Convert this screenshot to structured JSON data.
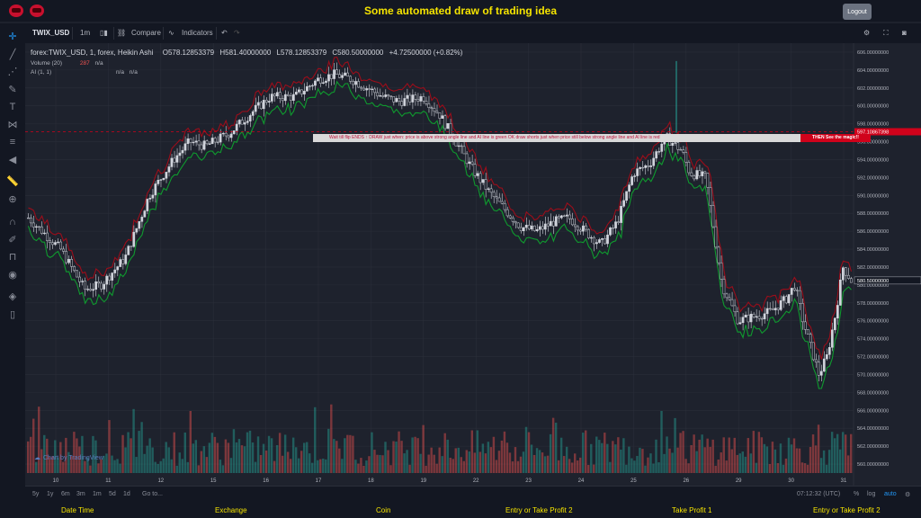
{
  "page": {
    "title": "Some automated draw of trading idea",
    "logout_label": "Logout"
  },
  "toolbar": {
    "symbol": "TWIX_USD",
    "interval": "1m",
    "compare_label": "Compare",
    "indicators_label": "Indicators"
  },
  "legend": {
    "main": "forex:TWIX_USD, 1, forex, Heikin Ashi",
    "o": "O578.12853379",
    "h": "H581.40000000",
    "l": "L578.12853379",
    "c": "C580.50000000",
    "chg": "+4.72500000 (+0.82%)",
    "volume_label": "Volume (20)",
    "volume_val": "287",
    "volume_na": "n/a",
    "ai_label": "AI (1, 1)",
    "ai_na1": "n/a",
    "ai_na2": "n/a"
  },
  "signal": {
    "text": "Wait till flip ENDS  ↑  DRAW just when:  price is above strong angle line and AI line is green        OK         draw shorts just when price still below strong angle line and AI line is red",
    "magic": "THEN See the magic!!",
    "level_label": "597.10867398"
  },
  "watermark": "Chart by TradingView",
  "footer": {
    "ranges": [
      "5y",
      "1y",
      "6m",
      "3m",
      "1m",
      "5d",
      "1d"
    ],
    "goto": "Go to...",
    "time": "07:12:32 (UTC)",
    "pct": "%",
    "log": "log",
    "auto": "auto"
  },
  "bottom_links": [
    "Date Time",
    "Exchange",
    "Coin",
    "Entry or Take Profit 2",
    "Take Profit 1",
    "Entry or Take Profit 2"
  ],
  "colors": {
    "up": "#d1d4dc",
    "down": "#131722",
    "vol_up": "#26a69a",
    "vol_down": "#ef5350",
    "angle_line": "#9b0d1a",
    "ai_line": "#0f9a2e",
    "accent": "#f5e400"
  },
  "chart_data": {
    "type": "candlestick",
    "x_ticks": [
      "10",
      "11",
      "12",
      "15",
      "16",
      "17",
      "18",
      "19",
      "22",
      "23",
      "24",
      "25",
      "26",
      "29",
      "30",
      "31"
    ],
    "y_ticks": [
      "560.00000000",
      "562.00000000",
      "564.00000000",
      "566.00000000",
      "568.00000000",
      "570.00000000",
      "572.00000000",
      "574.00000000",
      "576.00000000",
      "578.00000000",
      "580.00000000",
      "582.00000000",
      "584.00000000",
      "586.00000000",
      "588.00000000",
      "590.00000000",
      "592.00000000",
      "594.00000000",
      "596.00000000",
      "598.00000000",
      "600.00000000",
      "602.00000000",
      "604.00000000",
      "606.00000000"
    ],
    "ylim": [
      559,
      607
    ],
    "last_price": "580.50000000",
    "signal_level": 597.11,
    "close_path": [
      [
        0,
        587.5
      ],
      [
        4,
        584
      ],
      [
        7,
        579.5
      ],
      [
        9,
        580
      ],
      [
        12,
        583
      ],
      [
        15,
        590
      ],
      [
        18,
        594
      ],
      [
        20,
        596
      ],
      [
        22,
        595.5
      ],
      [
        25,
        597
      ],
      [
        28,
        599.5
      ],
      [
        30,
        601
      ],
      [
        33,
        601
      ],
      [
        36,
        603
      ],
      [
        38,
        603.5
      ],
      [
        40,
        603
      ],
      [
        42,
        602
      ],
      [
        44,
        601
      ],
      [
        46,
        600.5
      ],
      [
        49,
        601
      ],
      [
        51,
        599
      ],
      [
        53,
        596
      ],
      [
        55,
        593
      ],
      [
        57,
        590.5
      ],
      [
        59,
        588.5
      ],
      [
        61,
        586.5
      ],
      [
        63,
        586
      ],
      [
        65,
        587
      ],
      [
        67,
        587.5
      ],
      [
        69,
        586
      ],
      [
        71,
        584.5
      ],
      [
        73,
        587
      ],
      [
        75,
        592.5
      ],
      [
        77,
        593.5
      ],
      [
        79,
        596.5
      ],
      [
        81,
        595
      ],
      [
        82,
        592.5
      ],
      [
        84,
        592
      ],
      [
        86,
        580
      ],
      [
        88,
        576
      ],
      [
        90,
        576.5
      ],
      [
        92,
        577
      ],
      [
        94,
        578.5
      ],
      [
        95,
        580
      ],
      [
        96,
        576
      ],
      [
        97,
        573
      ],
      [
        98,
        570
      ],
      [
        99,
        572
      ],
      [
        100,
        576.5
      ],
      [
        101,
        582
      ],
      [
        102,
        580.5
      ]
    ],
    "volume_red_highlight": 287
  }
}
